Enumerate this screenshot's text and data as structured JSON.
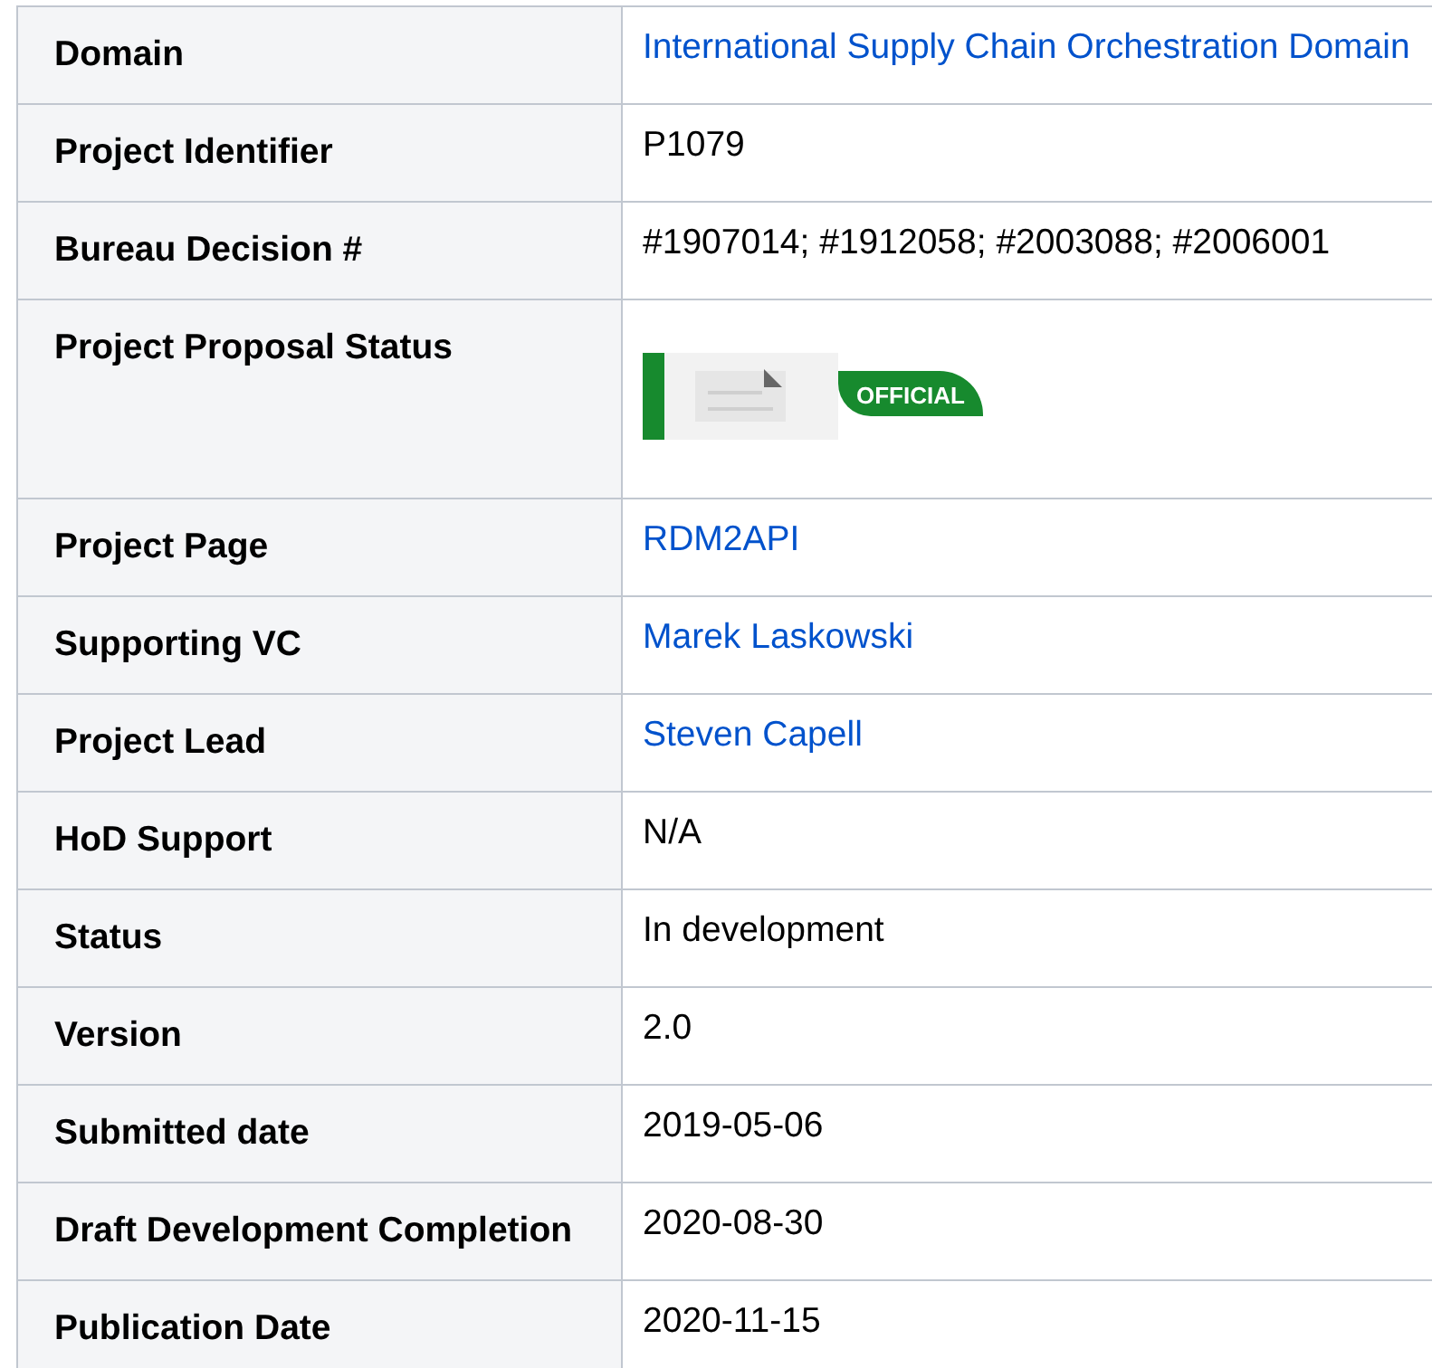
{
  "table": {
    "rows": [
      {
        "label": "Domain",
        "kind": "link",
        "value": "International Supply Chain Orchestration Domain"
      },
      {
        "label": "Project Identifier",
        "kind": "text",
        "value": "P1079"
      },
      {
        "label": "Bureau Decision #",
        "kind": "text",
        "value": "#1907014; #1912058; #2003088; #2006001"
      },
      {
        "label": "Project Proposal Status",
        "kind": "document",
        "badge": "OFFICIAL"
      },
      {
        "label": "Project Page",
        "kind": "link",
        "value": "RDM2API"
      },
      {
        "label": "Supporting VC",
        "kind": "link",
        "value": "Marek Laskowski"
      },
      {
        "label": "Project Lead",
        "kind": "link",
        "value": "Steven Capell"
      },
      {
        "label": "HoD Support",
        "kind": "text",
        "value": "N/A"
      },
      {
        "label": "Status",
        "kind": "text",
        "value": "In development"
      },
      {
        "label": "Version",
        "kind": "text",
        "value": "2.0"
      },
      {
        "label": "Submitted date",
        "kind": "text",
        "value": "2019-05-06"
      },
      {
        "label": "Draft Development Completion",
        "kind": "text",
        "value": "2020-08-30"
      },
      {
        "label": "Publication Date",
        "kind": "text",
        "value": "2020-11-15"
      }
    ]
  }
}
